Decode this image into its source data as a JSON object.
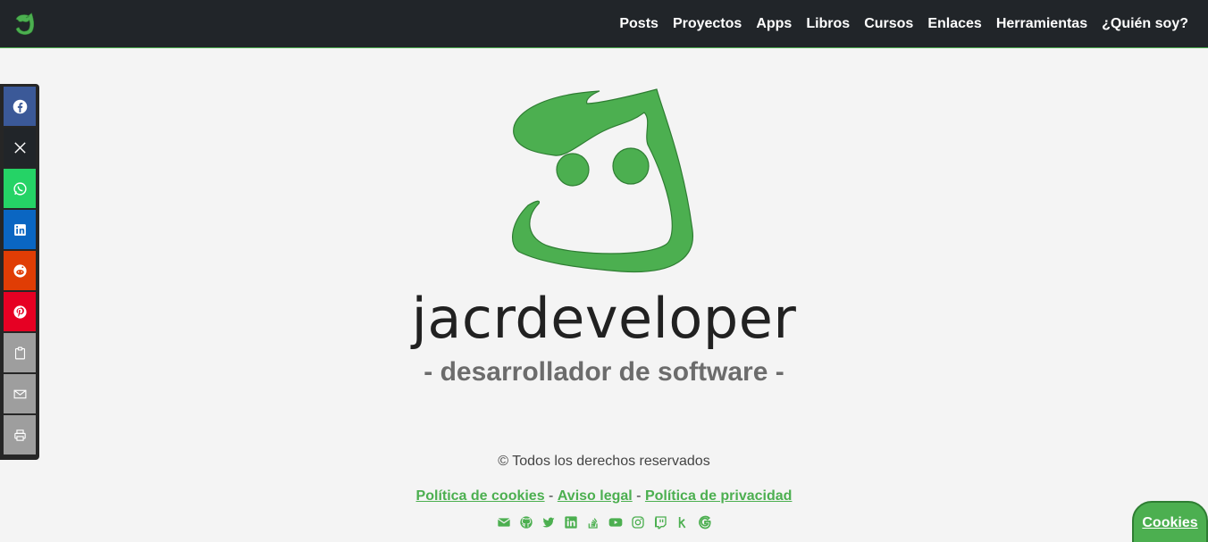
{
  "nav": {
    "links": [
      "Posts",
      "Proyectos",
      "Apps",
      "Libros",
      "Cursos",
      "Enlaces",
      "Herramientas",
      "¿Quién soy?"
    ]
  },
  "share": {
    "buttons": [
      {
        "icon": "facebook-icon",
        "color": "#3b5998"
      },
      {
        "icon": "x-icon",
        "color": "#212529"
      },
      {
        "icon": "whatsapp-icon",
        "color": "#25d366"
      },
      {
        "icon": "linkedin-icon",
        "color": "#0a66c2"
      },
      {
        "icon": "reddit-icon",
        "color": "#e03d05"
      },
      {
        "icon": "pinterest-icon",
        "color": "#e60023"
      },
      {
        "icon": "clipboard-icon",
        "color": "#9e9e9e"
      },
      {
        "icon": "email-icon",
        "color": "#9e9e9e"
      },
      {
        "icon": "print-icon",
        "color": "#9e9e9e"
      }
    ]
  },
  "hero": {
    "title": "jacrdeveloper",
    "tagline": "- desarrollador de software -",
    "brand_color": "#4caf50"
  },
  "footer": {
    "copyright": "© Todos los derechos reservados",
    "legal": {
      "cookies": "Política de cookies",
      "sep1": " - ",
      "aviso": "Aviso legal",
      "sep2": " - ",
      "privacidad": "Política de privacidad"
    },
    "socials": [
      "email-icon",
      "github-icon",
      "twitter-icon",
      "linkedin-icon",
      "stackoverflow-icon",
      "youtube-icon",
      "instagram-icon",
      "twitch-icon",
      "kofi-icon",
      "google-icon"
    ]
  },
  "cookies_button": "Cookies"
}
